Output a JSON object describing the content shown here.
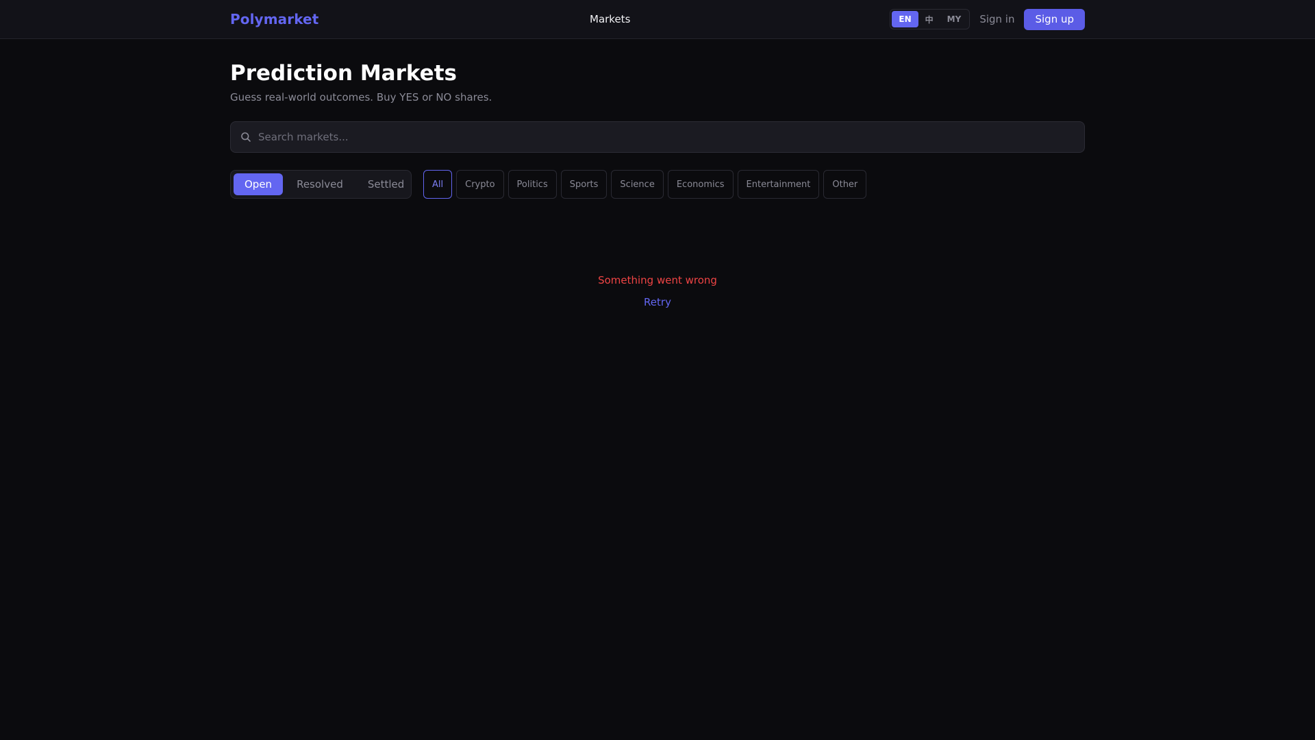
{
  "header": {
    "brand": "Polymarket",
    "nav": {
      "markets": "Markets"
    },
    "languages": [
      {
        "code": "EN",
        "active": true
      },
      {
        "code": "中",
        "active": false
      },
      {
        "code": "MY",
        "active": false
      }
    ],
    "sign_in": "Sign in",
    "sign_up": "Sign up"
  },
  "page": {
    "title": "Prediction Markets",
    "subtitle": "Guess real-world outcomes. Buy YES or NO shares."
  },
  "search": {
    "placeholder": "Search markets...",
    "value": ""
  },
  "status_tabs": [
    {
      "label": "Open",
      "active": true
    },
    {
      "label": "Resolved",
      "active": false
    },
    {
      "label": "Settled",
      "active": false
    }
  ],
  "categories": [
    {
      "label": "All",
      "active": true
    },
    {
      "label": "Crypto",
      "active": false
    },
    {
      "label": "Politics",
      "active": false
    },
    {
      "label": "Sports",
      "active": false
    },
    {
      "label": "Science",
      "active": false
    },
    {
      "label": "Economics",
      "active": false
    },
    {
      "label": "Entertainment",
      "active": false
    },
    {
      "label": "Other",
      "active": false
    }
  ],
  "error": {
    "message": "Something went wrong",
    "retry": "Retry"
  },
  "colors": {
    "accent": "#6366f1",
    "error": "#ef4444",
    "background": "#0b0b0e"
  },
  "icons": {
    "search": "search-icon"
  }
}
